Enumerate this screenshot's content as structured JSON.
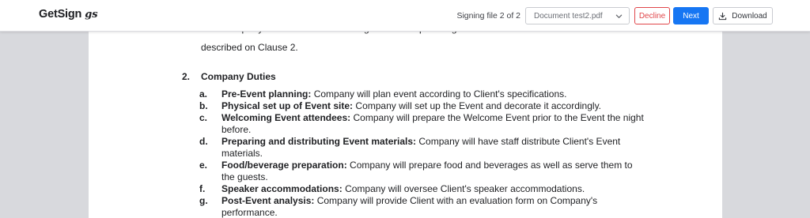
{
  "header": {
    "logo_text": "GetSign",
    "logo_mark": "gs",
    "file_status": "Signing file 2 of 2",
    "document_select": {
      "value": "Document test2.pdf",
      "icon": "chevron-down-icon"
    },
    "decline_label": "Decline",
    "next_label": "Next",
    "download_label": "Download",
    "download_icon": "download-icon"
  },
  "colors": {
    "accent": "#1676f3",
    "decline": "#e0464a",
    "canvas": "#d8d9dd"
  },
  "document": {
    "prev_line_partial": "The Company shall handle the management and planning duties for the Event in the manner",
    "prev_line_end": "described on Clause 2.",
    "section_number": "2.",
    "section_title": "Company Duties",
    "duties": [
      {
        "letter": "a.",
        "title": "Pre-Event planning:",
        "text": "Company will plan event according to Client's specifications."
      },
      {
        "letter": "b.",
        "title": "Physical set up of Event site:",
        "text": "Company will set up the Event and decorate it accordingly."
      },
      {
        "letter": "c.",
        "title": "Welcoming Event attendees:",
        "text": "Company will prepare the Welcome Event prior to the Event the night before."
      },
      {
        "letter": "d.",
        "title": "Preparing and distributing Event materials:",
        "text": "Company will have staff distribute Client's Event materials."
      },
      {
        "letter": "e.",
        "title": "Food/beverage preparation:",
        "text": "Company will prepare food and beverages as well as serve them to the guests."
      },
      {
        "letter": "f.",
        "title": "Speaker accommodations:",
        "text": "Company will oversee Client's speaker accommodations."
      },
      {
        "letter": "g.",
        "title": "Post-Event analysis:",
        "text": "Company will provide Client with an evaluation form on Company's performance."
      }
    ]
  }
}
